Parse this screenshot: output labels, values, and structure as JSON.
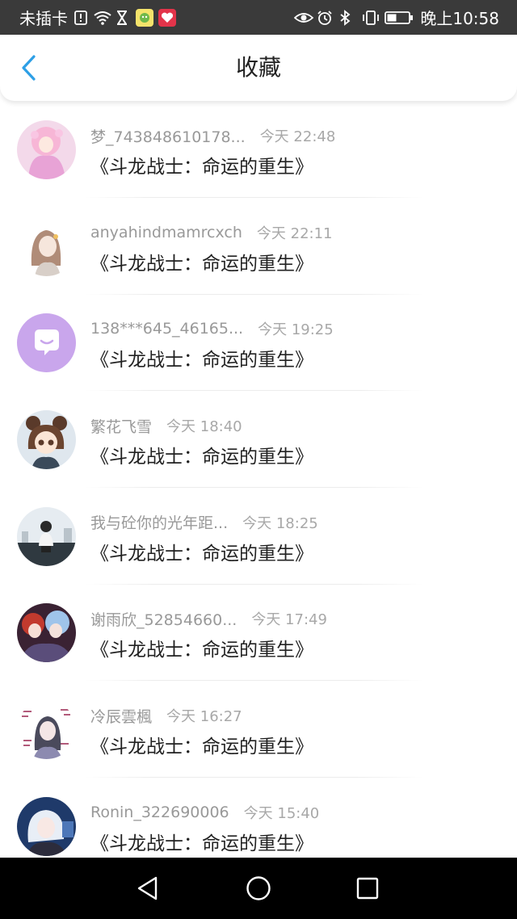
{
  "status_bar": {
    "carrier": "未插卡",
    "time": "晚上10:58",
    "icons": [
      "sim-alert-icon",
      "wifi-icon",
      "hourglass-icon",
      "app-icon",
      "app-heart-icon",
      "eye-icon",
      "alarm-icon",
      "bluetooth-icon",
      "vibrate-icon",
      "battery-icon"
    ]
  },
  "header": {
    "title": "收藏",
    "back_icon": "chevron-left-icon",
    "accent_color": "#2d9fe6"
  },
  "favorites": [
    {
      "name": "梦_743848610178...",
      "time": "今天 22:48",
      "title": "《斗龙战士：命运的重生》",
      "avatar": "pink-anime-girl"
    },
    {
      "name": "anyahindmamrcxch",
      "time": "今天 22:11",
      "title": "《斗龙战士：命运的重生》",
      "avatar": "sketch-girl"
    },
    {
      "name": "138***645_46165...",
      "time": "今天 19:25",
      "title": "《斗龙战士：命运的重生》",
      "avatar": "chat-bubble-default"
    },
    {
      "name": "繁花飞雪",
      "time": "今天 18:40",
      "title": "《斗龙战士：命运的重生》",
      "avatar": "chibi-girl"
    },
    {
      "name": "我与砼你的光年距...",
      "time": "今天 18:25",
      "title": "《斗龙战士：命运的重生》",
      "avatar": "photo-boy"
    },
    {
      "name": "谢雨欣_52854660...",
      "time": "今天 17:49",
      "title": "《斗龙战士：命运的重生》",
      "avatar": "anime-group"
    },
    {
      "name": "冷辰雲楓",
      "time": "今天 16:27",
      "title": "《斗龙战士：命运的重生》",
      "avatar": "ink-anime-character"
    },
    {
      "name": "Ronin_322690006",
      "time": "今天 15:40",
      "title": "《斗龙战士：命运的重生》",
      "avatar": "anime-boy-blue"
    }
  ],
  "nav_bar": {
    "back_icon": "triangle-back-icon",
    "home_icon": "circle-home-icon",
    "recents_icon": "square-recents-icon"
  }
}
